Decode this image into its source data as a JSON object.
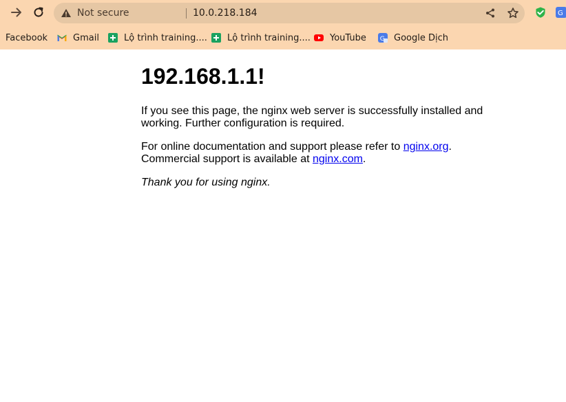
{
  "browser": {
    "security_label": "Not secure",
    "url": "10.0.218.184",
    "colors": {
      "chrome_bg": "#fbd6b0",
      "omnibox_bg": "#e6c7a4"
    },
    "icons": [
      "back-arrow-icon",
      "reload-icon",
      "warning-icon",
      "share-icon",
      "star-icon",
      "extension-shield-icon",
      "extension-translate-icon"
    ]
  },
  "bookmarks": [
    {
      "label": "Facebook",
      "icon": "none"
    },
    {
      "label": "Gmail",
      "icon": "gmail-icon"
    },
    {
      "label": "Lộ trình training....",
      "icon": "sheets-icon"
    },
    {
      "label": "Lộ trình training....",
      "icon": "sheets-icon"
    },
    {
      "label": "YouTube",
      "icon": "youtube-icon"
    },
    {
      "label": "Google Dịch",
      "icon": "google-translate-icon"
    }
  ],
  "page": {
    "title": "192.168.1.1!",
    "para1": "If you see this page, the nginx web server is successfully installed and working. Further configuration is required.",
    "para2_prefix": "For online documentation and support please refer to ",
    "link1": "nginx.org",
    "para2_mid": ".",
    "para2_line2_prefix": "Commercial support is available at ",
    "link2": "nginx.com",
    "para2_suffix": ".",
    "thanks": "Thank you for using nginx."
  }
}
